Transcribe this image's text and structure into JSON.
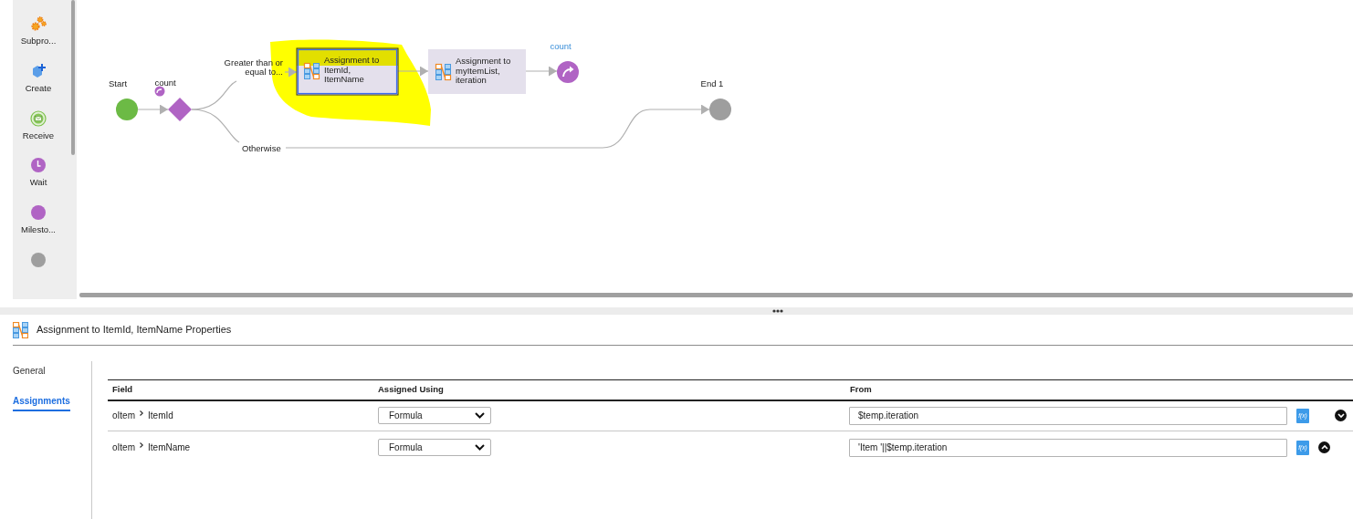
{
  "palette": {
    "items": [
      {
        "kind": "subprocess",
        "label": "Subpro..."
      },
      {
        "kind": "create",
        "label": "Create"
      },
      {
        "kind": "receive",
        "label": "Receive"
      },
      {
        "kind": "wait",
        "label": "Wait"
      },
      {
        "kind": "milestone",
        "label": "Milesto..."
      },
      {
        "kind": "end"
      }
    ]
  },
  "canvas": {
    "nodes": [
      {
        "kind": "start",
        "label": "Start",
        "selected": false,
        "highlighted": false
      },
      {
        "kind": "decision",
        "label": "count",
        "selected": false,
        "highlighted": false
      },
      {
        "kind": "assignment",
        "label_lines": [
          "Assignment to",
          "ItemId,",
          "ItemName"
        ],
        "selected": true,
        "highlighted": true
      },
      {
        "kind": "assignment",
        "label_lines": [
          "Assignment to",
          "myItemList,",
          "iteration"
        ],
        "selected": false,
        "highlighted": false
      },
      {
        "kind": "jump",
        "label": "count",
        "selected": false,
        "highlighted": false
      },
      {
        "kind": "end",
        "label": "End 1",
        "selected": false,
        "highlighted": false
      }
    ],
    "branches": [
      {
        "label_lines": [
          "Greater than or",
          "equal to..."
        ]
      },
      {
        "label_lines": [
          "Otherwise"
        ]
      }
    ]
  },
  "properties": {
    "title": "Assignment to ItemId, ItemName Properties",
    "tabs": [
      {
        "label": "General",
        "selected": false
      },
      {
        "label": "Assignments",
        "selected": true
      }
    ],
    "table": {
      "columns": [
        "Field",
        "Assigned Using",
        "From"
      ],
      "rows": [
        {
          "object": "oItem",
          "field": "ItemId",
          "assigned_using": "Formula",
          "from": "$temp.iteration",
          "formula_button": "f(x)",
          "can_move_up": false,
          "can_move_down": true
        },
        {
          "object": "oItem",
          "field": "ItemName",
          "assigned_using": "Formula",
          "from": "'Item '||$temp.iteration",
          "formula_button": "f(x)",
          "can_move_up": true,
          "can_move_down": false
        }
      ]
    }
  }
}
